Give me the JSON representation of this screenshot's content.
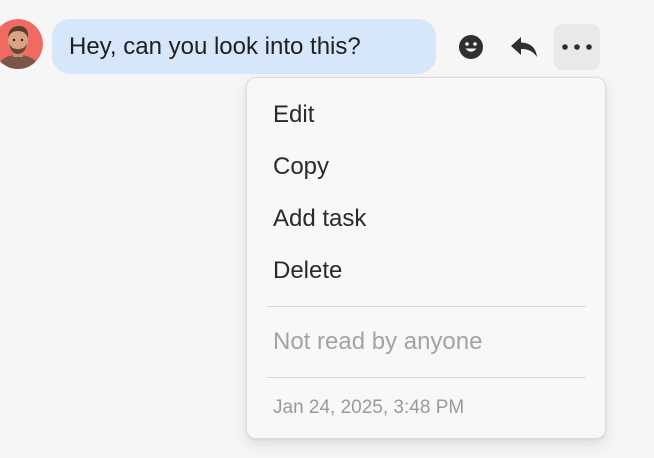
{
  "message": {
    "text": "Hey, can you look into this?"
  },
  "actions": {
    "emoji_icon": "emoji-icon",
    "reply_icon": "reply-icon",
    "more_icon": "more-icon"
  },
  "menu": {
    "items": [
      {
        "label": "Edit"
      },
      {
        "label": "Copy"
      },
      {
        "label": "Add task"
      },
      {
        "label": "Delete"
      }
    ],
    "read_status": "Not read by anyone",
    "timestamp": "Jan 24, 2025, 3:48 PM"
  },
  "colors": {
    "bubble": "#d6e6fb",
    "background": "#f6f6f6",
    "avatar_bg": "#ee6a63",
    "icon": "#2f2f2f"
  }
}
